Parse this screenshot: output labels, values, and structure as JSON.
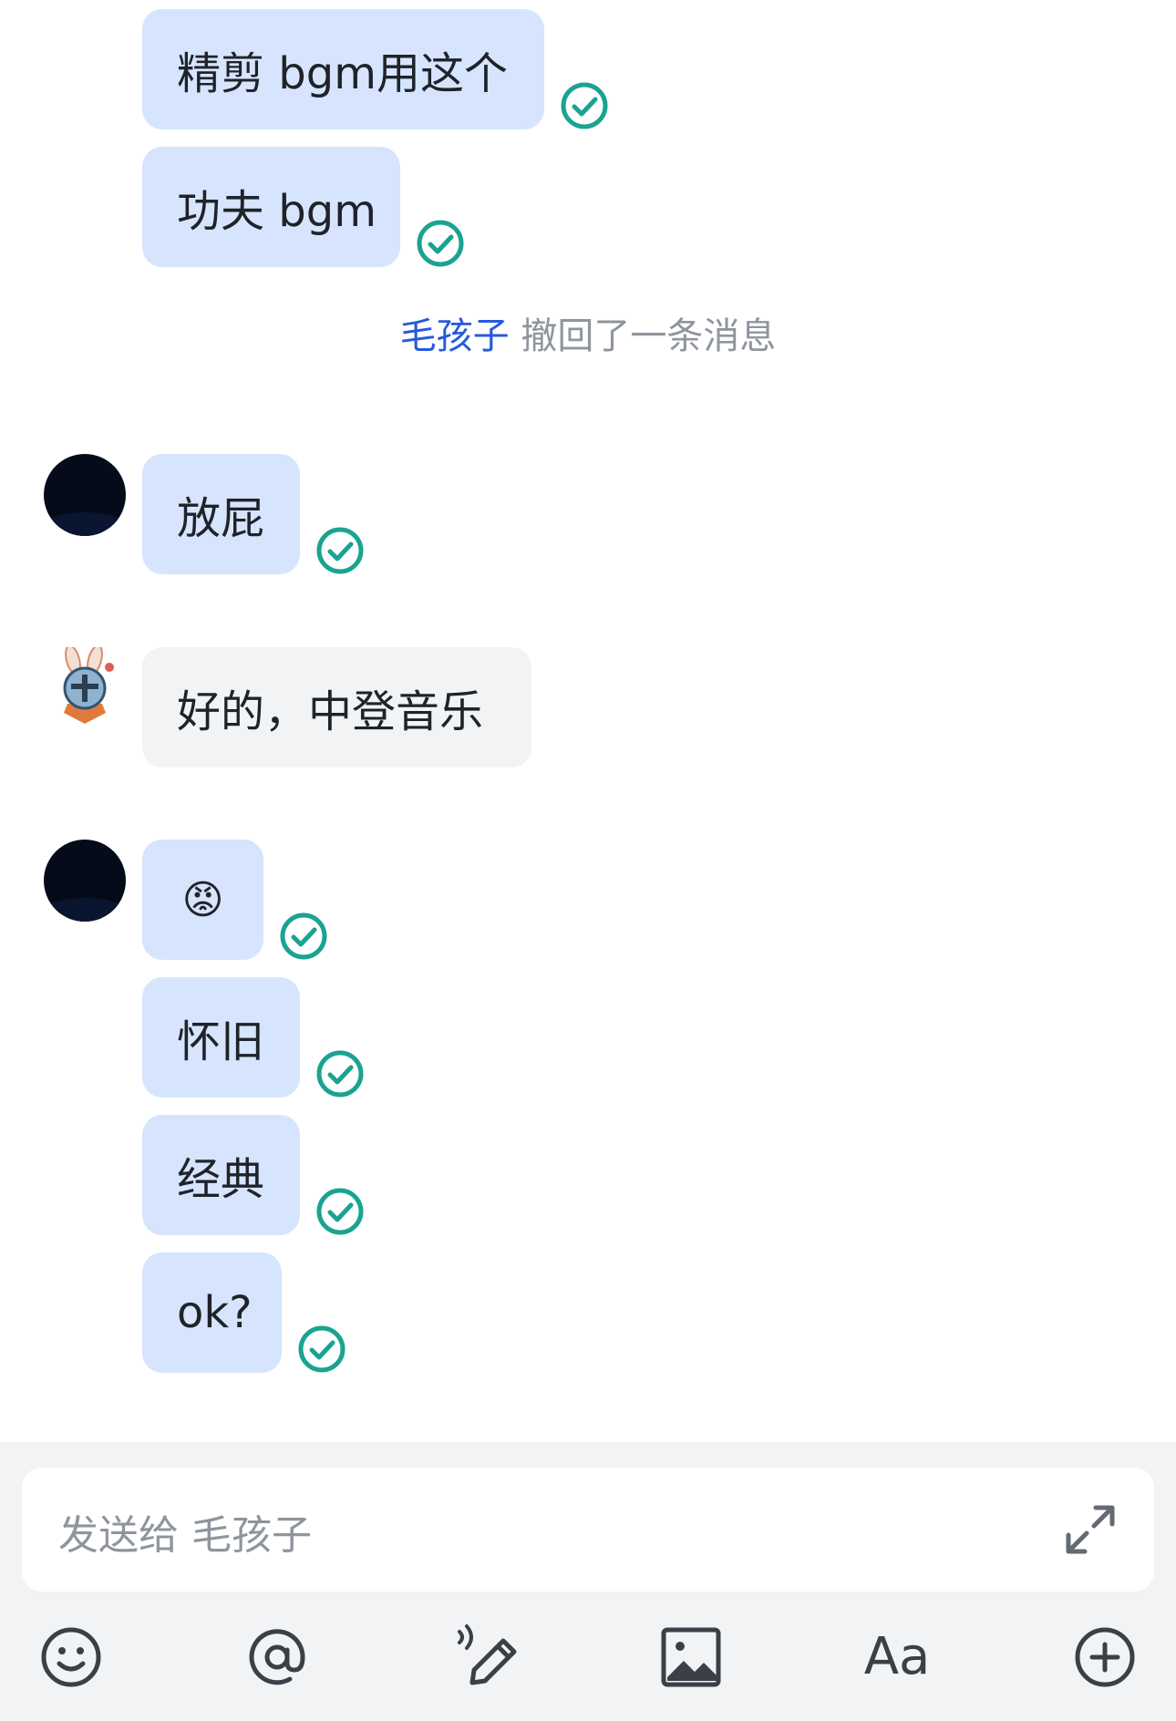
{
  "messages": [
    {
      "text": "精剪 bgm用这个",
      "status": "read"
    },
    {
      "text": "功夫 bgm",
      "status": "read"
    },
    {
      "text": "放屁",
      "status": "read"
    },
    {
      "text": "好的，中登音乐"
    },
    {
      "emoji": "😡",
      "status": "read"
    },
    {
      "text": "怀旧",
      "status": "read"
    },
    {
      "text": "经典",
      "status": "read"
    },
    {
      "text": "ok?",
      "status": "read"
    }
  ],
  "recall_notice": {
    "who": "毛孩子",
    "text": "撤回了一条消息"
  },
  "composer": {
    "placeholder": "发送给 毛孩子"
  },
  "toolbar": {
    "icons": [
      "emoji-icon",
      "mention-icon",
      "voice-pen-icon",
      "image-icon",
      "font-icon",
      "plus-icon"
    ],
    "font_label": "Aa"
  },
  "colors": {
    "self_bubble": "#d6e5fd",
    "other_bubble": "#f2f3f5",
    "read_check": "#1aa391",
    "mention_blue": "#245bdb"
  }
}
